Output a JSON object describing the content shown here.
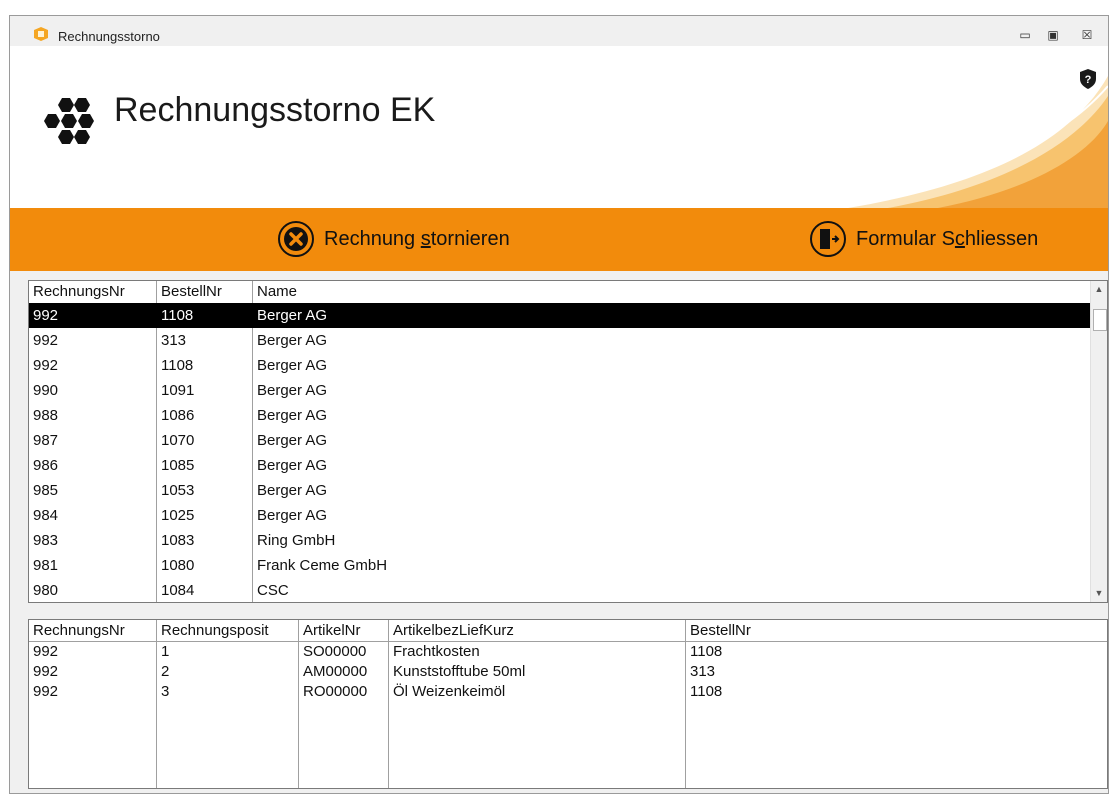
{
  "window": {
    "title": "Rechnungsstorno",
    "controls": {
      "minimize": "▭",
      "maximize": "▣",
      "close": "☒"
    }
  },
  "header": {
    "app_title": "Rechnungsstorno EK",
    "logo_icon": "hexagon-cluster-icon",
    "help_icon": "shield-question-icon",
    "accent_color": "#f28b0c"
  },
  "toolbar": {
    "cancel_invoice": {
      "pre": "Rechnung ",
      "underline": "s",
      "post": "tornieren",
      "icon": "cancel-circle-icon"
    },
    "close_form": {
      "pre": "Formular S",
      "underline": "c",
      "post": "hliessen",
      "icon": "exit-door-icon"
    }
  },
  "invoices": {
    "columns": [
      "RechnungsNr",
      "BestellNr",
      "Name"
    ],
    "rows": [
      {
        "nr": "992",
        "bestell": "1108",
        "name": "Berger AG"
      },
      {
        "nr": "992",
        "bestell": "313",
        "name": "Berger AG"
      },
      {
        "nr": "992",
        "bestell": "1108",
        "name": "Berger AG"
      },
      {
        "nr": "990",
        "bestell": "1091",
        "name": "Berger AG"
      },
      {
        "nr": "988",
        "bestell": "1086",
        "name": "Berger AG"
      },
      {
        "nr": "987",
        "bestell": "1070",
        "name": "Berger AG"
      },
      {
        "nr": "986",
        "bestell": "1085",
        "name": "Berger AG"
      },
      {
        "nr": "985",
        "bestell": "1053",
        "name": "Berger AG"
      },
      {
        "nr": "984",
        "bestell": "1025",
        "name": "Berger AG"
      },
      {
        "nr": "983",
        "bestell": "1083",
        "name": "Ring  GmbH"
      },
      {
        "nr": "981",
        "bestell": "1080",
        "name": "Frank Ceme GmbH"
      },
      {
        "nr": "980",
        "bestell": "1084",
        "name": "CSC"
      }
    ]
  },
  "positions": {
    "columns": [
      "RechnungsNr",
      "Rechnungsposit",
      "ArtikelNr",
      "ArtikelbezLiefKurz",
      "BestellNr"
    ],
    "rows": [
      {
        "nr": "992",
        "pos": "1",
        "artikel": "SO00000",
        "bez": "Frachtkosten",
        "bestell": "1108"
      },
      {
        "nr": "992",
        "pos": "2",
        "artikel": "AM00000",
        "bez": "Kunststofftube 50ml",
        "bestell": "313"
      },
      {
        "nr": "992",
        "pos": "3",
        "artikel": "RO00000",
        "bez": "Öl Weizenkeimöl",
        "bestell": "1108"
      }
    ]
  }
}
